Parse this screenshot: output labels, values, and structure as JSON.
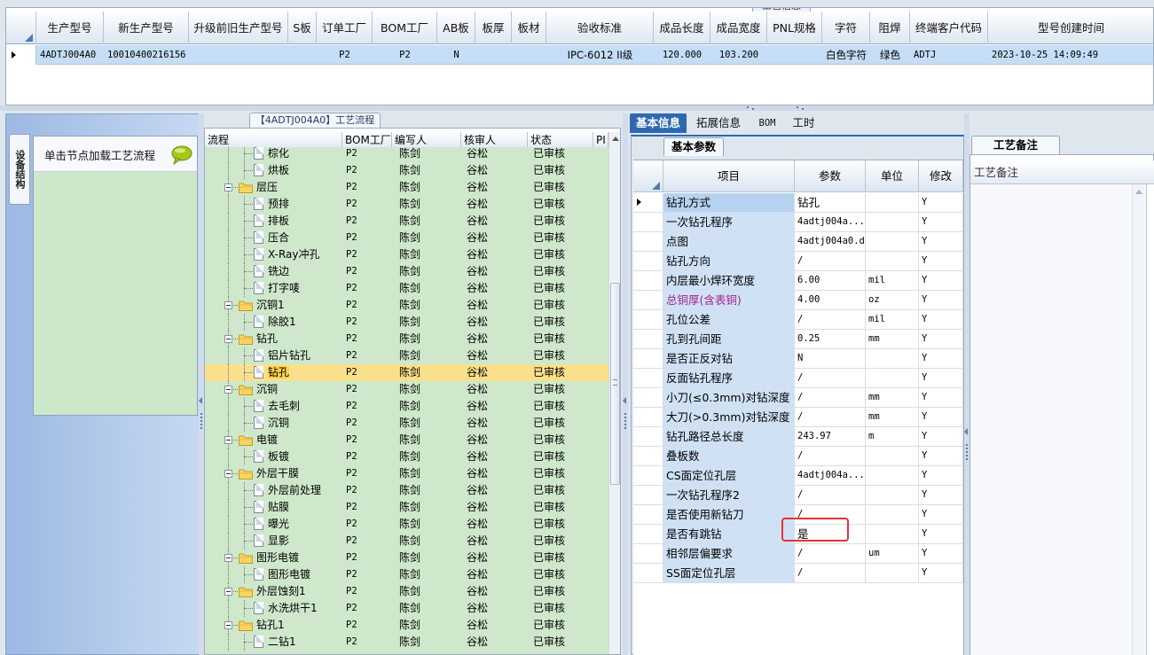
{
  "top_grid": {
    "hidden_tab_label": "工艺信息",
    "columns": [
      "生产型号",
      "新生产型号",
      "升级前旧生产型号",
      "S板",
      "订单工厂",
      "BOM工厂",
      "AB板",
      "板厚",
      "板材",
      "验收标准",
      "成品长度",
      "成品宽度",
      "PNL规格",
      "字符",
      "阻焊",
      "终端客户代码",
      "型号创建时间"
    ],
    "row": [
      "4ADTJ004A0",
      "10010400216156",
      "",
      "",
      "P2",
      "P2",
      "N",
      "",
      "",
      "IPC-6012 II级",
      "120.000",
      "103.200",
      "",
      "白色字符",
      "绿色",
      "ADTJ",
      "2023-10-25 14:09:49"
    ]
  },
  "left_panel": {
    "vertical_tab_label": "设备结构",
    "load_hint": "单击节点加载工艺流程"
  },
  "tree": {
    "title": "【4ADTJ004A0】工艺流程",
    "columns": [
      "流程",
      "BOM工厂",
      "编写人",
      "核审人",
      "状态",
      "PI"
    ],
    "rows": [
      {
        "name": "棕化",
        "type": "leaf",
        "bom": "P2",
        "writer": "陈剑",
        "reviewer": "谷松",
        "status": "已审核"
      },
      {
        "name": "烘板",
        "type": "leaf",
        "bom": "P2",
        "writer": "陈剑",
        "reviewer": "谷松",
        "status": "已审核"
      },
      {
        "name": "层压",
        "type": "folder",
        "bom": "P2",
        "writer": "陈剑",
        "reviewer": "谷松",
        "status": "已审核"
      },
      {
        "name": "预排",
        "type": "leaf",
        "bom": "P2",
        "writer": "陈剑",
        "reviewer": "谷松",
        "status": "已审核"
      },
      {
        "name": "排板",
        "type": "leaf",
        "bom": "P2",
        "writer": "陈剑",
        "reviewer": "谷松",
        "status": "已审核"
      },
      {
        "name": "压合",
        "type": "leaf",
        "bom": "P2",
        "writer": "陈剑",
        "reviewer": "谷松",
        "status": "已审核"
      },
      {
        "name": "X-Ray冲孔",
        "type": "leaf",
        "bom": "P2",
        "writer": "陈剑",
        "reviewer": "谷松",
        "status": "已审核"
      },
      {
        "name": "铣边",
        "type": "leaf",
        "bom": "P2",
        "writer": "陈剑",
        "reviewer": "谷松",
        "status": "已审核"
      },
      {
        "name": "打字唛",
        "type": "leaf",
        "bom": "P2",
        "writer": "陈剑",
        "reviewer": "谷松",
        "status": "已审核"
      },
      {
        "name": "沉铜1",
        "type": "folder",
        "bom": "P2",
        "writer": "陈剑",
        "reviewer": "谷松",
        "status": "已审核"
      },
      {
        "name": "除胶1",
        "type": "leaf",
        "bom": "P2",
        "writer": "陈剑",
        "reviewer": "谷松",
        "status": "已审核"
      },
      {
        "name": "钻孔",
        "type": "folder",
        "bom": "P2",
        "writer": "陈剑",
        "reviewer": "谷松",
        "status": "已审核"
      },
      {
        "name": "铝片钻孔",
        "type": "leaf",
        "bom": "P2",
        "writer": "陈剑",
        "reviewer": "谷松",
        "status": "已审核"
      },
      {
        "name": "钻孔",
        "type": "leaf",
        "bom": "P2",
        "writer": "陈剑",
        "reviewer": "谷松",
        "status": "已审核",
        "selected": true
      },
      {
        "name": "沉铜",
        "type": "folder",
        "bom": "P2",
        "writer": "陈剑",
        "reviewer": "谷松",
        "status": "已审核"
      },
      {
        "name": "去毛刺",
        "type": "leaf",
        "bom": "P2",
        "writer": "陈剑",
        "reviewer": "谷松",
        "status": "已审核"
      },
      {
        "name": "沉铜",
        "type": "leaf",
        "bom": "P2",
        "writer": "陈剑",
        "reviewer": "谷松",
        "status": "已审核"
      },
      {
        "name": "电镀",
        "type": "folder",
        "bom": "P2",
        "writer": "陈剑",
        "reviewer": "谷松",
        "status": "已审核"
      },
      {
        "name": "板镀",
        "type": "leaf",
        "bom": "P2",
        "writer": "陈剑",
        "reviewer": "谷松",
        "status": "已审核"
      },
      {
        "name": "外层干膜",
        "type": "folder",
        "bom": "P2",
        "writer": "陈剑",
        "reviewer": "谷松",
        "status": "已审核"
      },
      {
        "name": "外层前处理",
        "type": "leaf",
        "bom": "P2",
        "writer": "陈剑",
        "reviewer": "谷松",
        "status": "已审核"
      },
      {
        "name": "贴膜",
        "type": "leaf",
        "bom": "P2",
        "writer": "陈剑",
        "reviewer": "谷松",
        "status": "已审核"
      },
      {
        "name": "曝光",
        "type": "leaf",
        "bom": "P2",
        "writer": "陈剑",
        "reviewer": "谷松",
        "status": "已审核"
      },
      {
        "name": "显影",
        "type": "leaf",
        "bom": "P2",
        "writer": "陈剑",
        "reviewer": "谷松",
        "status": "已审核"
      },
      {
        "name": "图形电镀",
        "type": "folder",
        "bom": "P2",
        "writer": "陈剑",
        "reviewer": "谷松",
        "status": "已审核"
      },
      {
        "name": "图形电镀",
        "type": "leaf",
        "bom": "P2",
        "writer": "陈剑",
        "reviewer": "谷松",
        "status": "已审核"
      },
      {
        "name": "外层蚀刻1",
        "type": "folder",
        "bom": "P2",
        "writer": "陈剑",
        "reviewer": "谷松",
        "status": "已审核"
      },
      {
        "name": "水洗烘干1",
        "type": "leaf",
        "bom": "P2",
        "writer": "陈剑",
        "reviewer": "谷松",
        "status": "已审核"
      },
      {
        "name": "钻孔1",
        "type": "folder",
        "bom": "P2",
        "writer": "陈剑",
        "reviewer": "谷松",
        "status": "已审核"
      },
      {
        "name": "二钻1",
        "type": "leaf",
        "bom": "P2",
        "writer": "陈剑",
        "reviewer": "谷松",
        "status": "已审核"
      }
    ]
  },
  "right_tabs": [
    "基本信息",
    "拓展信息",
    "BOM",
    "工时"
  ],
  "basic_params": {
    "tab_label": "基本参数",
    "columns": [
      "项目",
      "参数",
      "单位",
      "修改"
    ],
    "rows": [
      {
        "item": "钻孔方式",
        "value": "钻孔",
        "unit": "",
        "edit": "Y",
        "selected": true
      },
      {
        "item": "一次钻孔程序",
        "value": "4adtj004a...",
        "unit": "",
        "edit": "Y"
      },
      {
        "item": "点图",
        "value": "4adtj004a0.d",
        "unit": "",
        "edit": "Y"
      },
      {
        "item": "钻孔方向",
        "value": "/",
        "unit": "",
        "edit": "Y"
      },
      {
        "item": "内层最小焊环宽度",
        "value": "6.00",
        "unit": "mil",
        "edit": "Y"
      },
      {
        "item": "总铜厚(含表铜)",
        "value": "4.00",
        "unit": "oz",
        "edit": "Y",
        "highlight": true
      },
      {
        "item": "孔位公差",
        "value": "/",
        "unit": "mil",
        "edit": "Y"
      },
      {
        "item": "孔到孔间距",
        "value": "0.25",
        "unit": "mm",
        "edit": "Y"
      },
      {
        "item": "是否正反对钻",
        "value": "N",
        "unit": "",
        "edit": "Y"
      },
      {
        "item": "反面钻孔程序",
        "value": "/",
        "unit": "",
        "edit": "Y"
      },
      {
        "item": "小刀(≤0.3mm)对钻深度",
        "value": "/",
        "unit": "mm",
        "edit": "Y"
      },
      {
        "item": "大刀(>0.3mm)对钻深度",
        "value": "/",
        "unit": "mm",
        "edit": "Y"
      },
      {
        "item": "钻孔路径总长度",
        "value": "243.97",
        "unit": "m",
        "edit": "Y"
      },
      {
        "item": "叠板数",
        "value": "/",
        "unit": "",
        "edit": "Y"
      },
      {
        "item": "CS面定位孔层",
        "value": "4adtj004a...",
        "unit": "",
        "edit": "Y"
      },
      {
        "item": "一次钻孔程序2",
        "value": "/",
        "unit": "",
        "edit": "Y"
      },
      {
        "item": "是否使用新钻刀",
        "value": "/",
        "unit": "",
        "edit": "Y"
      },
      {
        "item": "是否有跳钻",
        "value": "是",
        "unit": "",
        "edit": "Y"
      },
      {
        "item": "相邻层偏要求",
        "value": "/",
        "unit": "um",
        "edit": "Y"
      },
      {
        "item": "SS面定位孔层",
        "value": "/",
        "unit": "",
        "edit": "Y"
      }
    ]
  },
  "process_notes": {
    "tab_label": "工艺备注",
    "column_label": "工艺备注"
  },
  "colors": {
    "active_tab": "#2e69b0",
    "selected_tree_row": "#fbe08c",
    "tree_background": "#cfe8cc",
    "highlight_text": "#a2228f",
    "callout_box": "#e23434"
  }
}
